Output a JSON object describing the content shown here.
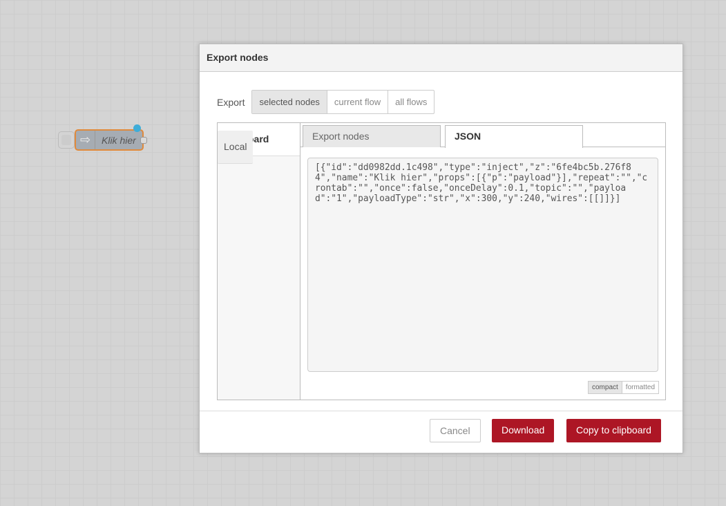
{
  "canvas": {
    "node": {
      "label": "Klik hier",
      "icon": "arrow-right-icon",
      "color": "#a6acb3"
    }
  },
  "dialog": {
    "title": "Export nodes",
    "export_label": "Export",
    "scope_options": [
      "selected nodes",
      "current flow",
      "all flows"
    ],
    "selected_scope": "selected nodes",
    "side": [
      "Clipboard",
      "Local"
    ],
    "tabs": [
      "Export nodes",
      "JSON"
    ],
    "active_tab": "JSON",
    "json": "[{\"id\":\"dd0982dd.1c498\",\"type\":\"inject\",\"z\":\"6fe4bc5b.276f84\",\"name\":\"Klik hier\",\"props\":[{\"p\":\"payload\"}],\"repeat\":\"\",\"crontab\":\"\",\"once\":false,\"onceDelay\":0.1,\"topic\":\"\",\"payload\":\"1\",\"payloadType\":\"str\",\"x\":300,\"y\":240,\"wires\":[[]]}]",
    "format_options": [
      "compact",
      "formatted"
    ],
    "buttons": {
      "cancel": "Cancel",
      "download": "Download",
      "copy": "Copy to clipboard"
    },
    "accent": "#ad1625"
  }
}
